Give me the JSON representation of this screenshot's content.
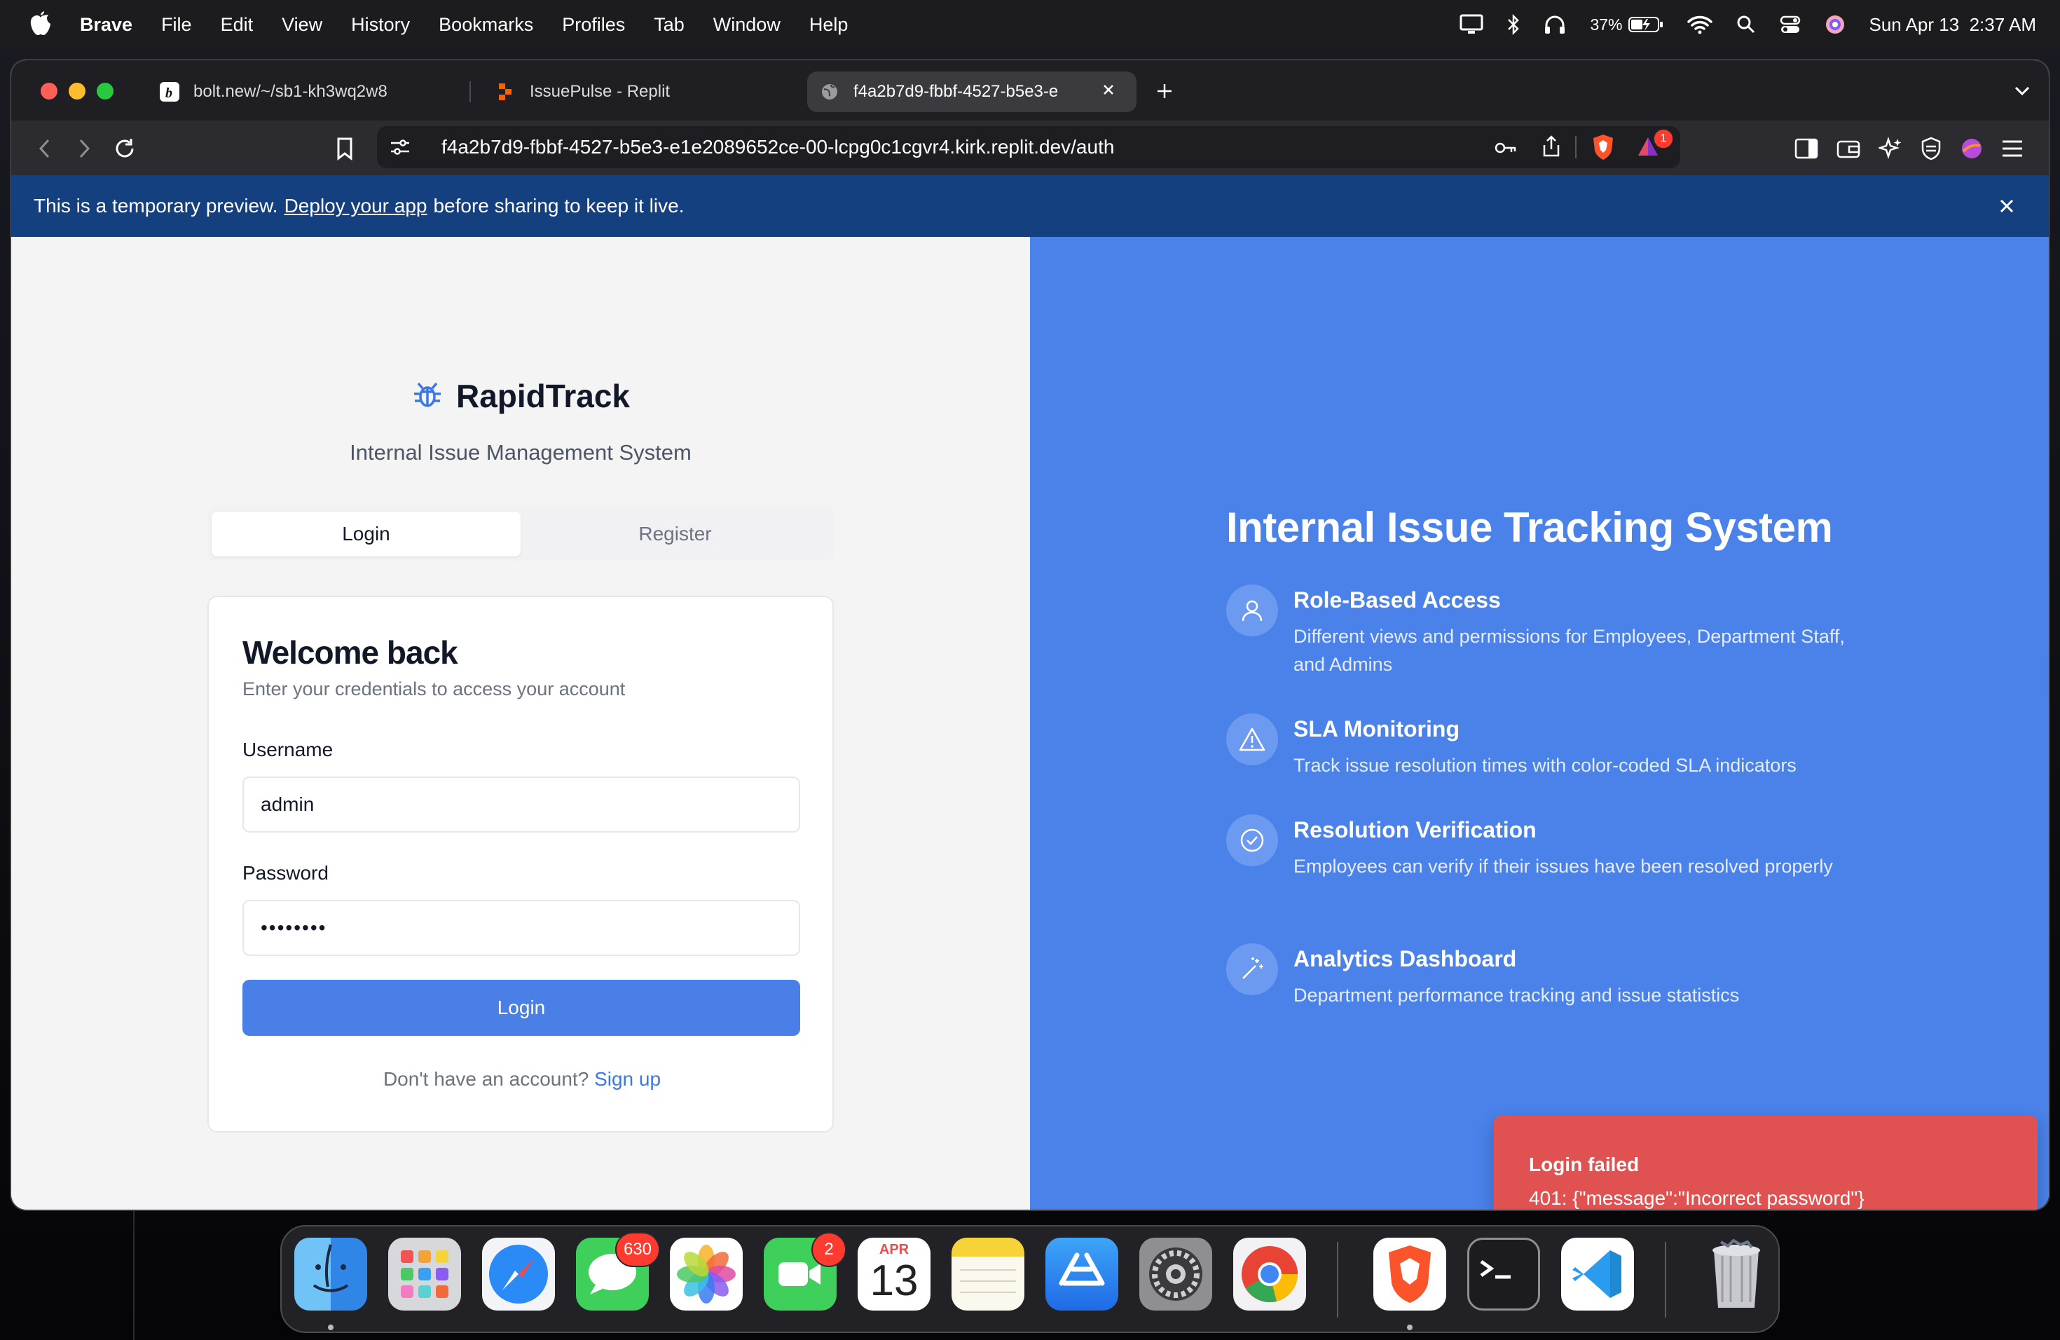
{
  "menubar": {
    "app_name": "Brave",
    "items": [
      "File",
      "Edit",
      "View",
      "History",
      "Bookmarks",
      "Profiles",
      "Tab",
      "Window",
      "Help"
    ],
    "battery": "37%",
    "clock": "Sun Apr 13  2:37 AM"
  },
  "tabs": [
    {
      "title": "bolt.new/~/sb1-kh3wq2w8",
      "icon": "bolt-icon"
    },
    {
      "title": "IssuePulse - Replit",
      "icon": "replit-icon"
    },
    {
      "title": "f4a2b7d9-fbbf-4527-b5e3-e",
      "icon": "globe-icon"
    }
  ],
  "address_bar": {
    "url": "f4a2b7d9-fbbf-4527-b5e3-e1e2089652ce-00-lcpg0c1cgvr4.kirk.replit.dev/auth",
    "shield_badge": "1"
  },
  "banner": {
    "prefix": "This is a temporary preview.",
    "link": "Deploy your app",
    "suffix": "before sharing to keep it live."
  },
  "auth": {
    "brand": "RapidTrack",
    "subtitle": "Internal Issue Management System",
    "tab_login": "Login",
    "tab_register": "Register",
    "card_title": "Welcome back",
    "card_subtitle": "Enter your credentials to access your account",
    "username_label": "Username",
    "username_value": "admin",
    "password_label": "Password",
    "password_value": "••••••••",
    "login_button": "Login",
    "signup_prompt": "Don't have an account?",
    "signup_link": "Sign up"
  },
  "hero": {
    "title": "Internal Issue Tracking System",
    "features": [
      {
        "title": "Role-Based Access",
        "desc": "Different views and permissions for Employees, Department Staff, and Admins",
        "icon": "user-icon"
      },
      {
        "title": "SLA Monitoring",
        "desc": "Track issue resolution times with color-coded SLA indicators",
        "icon": "warning-icon"
      },
      {
        "title": "Resolution Verification",
        "desc": "Employees can verify if their issues have been resolved properly",
        "icon": "check-circle-icon"
      },
      {
        "title": "Analytics Dashboard",
        "desc": "Department performance tracking and issue statistics",
        "icon": "magic-wand-icon"
      }
    ]
  },
  "toast": {
    "title": "Login failed",
    "message": "401: {\"message\":\"Incorrect password\"}"
  },
  "dock": {
    "apps": [
      "Finder",
      "Launchpad",
      "Safari",
      "Messages",
      "Photos",
      "FaceTime",
      "Calendar",
      "Notes",
      "App Store",
      "System Settings",
      "Chrome",
      "Brave",
      "Terminal",
      "VS Code",
      "Trash"
    ],
    "messages_badge": "630",
    "facetime_badge": "2",
    "calendar_month": "APR",
    "calendar_day": "13"
  },
  "colors": {
    "accent": "#4a7fe8",
    "hero_bg": "#4a82ea",
    "banner_bg": "#15407f",
    "toast_bg": "#e05252"
  }
}
